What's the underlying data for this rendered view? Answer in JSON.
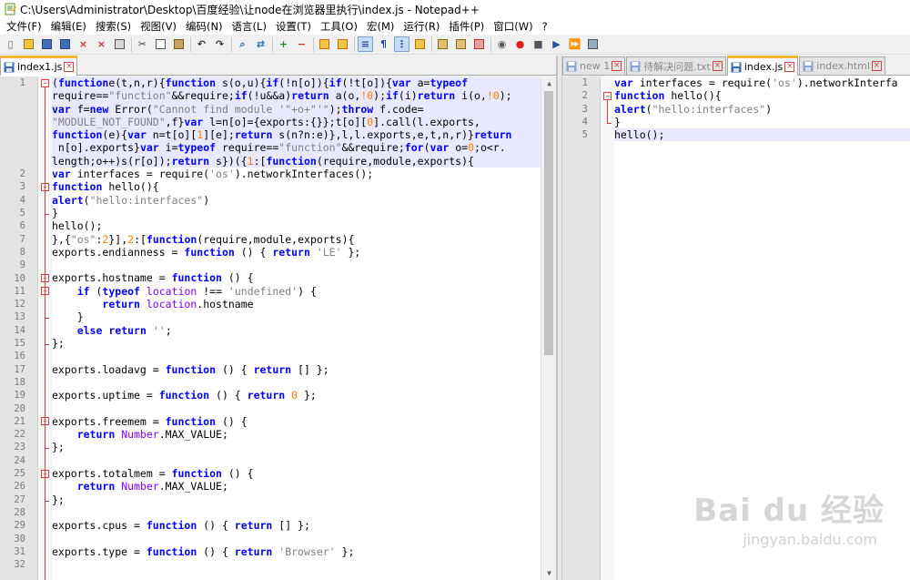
{
  "window": {
    "title": "C:\\Users\\Administrator\\Desktop\\百度经验\\让node在浏览器里执行\\index.js - Notepad++"
  },
  "menu": [
    "文件(F)",
    "编辑(E)",
    "搜索(S)",
    "视图(V)",
    "编码(N)",
    "语言(L)",
    "设置(T)",
    "工具(O)",
    "宏(M)",
    "运行(R)",
    "插件(P)",
    "窗口(W)",
    "?"
  ],
  "toolbar": {
    "icons": [
      "new-file-icon",
      "open-file-icon",
      "save-icon",
      "save-all-icon",
      "close-icon",
      "close-all-icon",
      "print-icon",
      "cut-icon",
      "copy-icon",
      "paste-icon",
      "undo-icon",
      "redo-icon",
      "find-icon",
      "replace-icon",
      "zoom-in-icon",
      "zoom-out-icon",
      "sync-vertical-icon",
      "sync-horizontal-icon",
      "word-wrap-icon",
      "show-all-chars-icon",
      "indent-guide-icon",
      "user-lang-icon",
      "doc-map-icon",
      "function-list-icon",
      "folder-workspace-icon",
      "monitor-icon",
      "macro-record-icon",
      "macro-stop-icon",
      "macro-play-icon",
      "macro-play-multi-icon",
      "macro-save-icon"
    ],
    "active": [
      "word-wrap-icon",
      "indent-guide-icon"
    ]
  },
  "left": {
    "tabs": [
      {
        "label": "index1.js",
        "active": true
      }
    ],
    "lines": [
      {
        "n": "1",
        "fold": "open",
        "wrapped": true,
        "hl": true,
        "segs": [
          [
            "sym",
            "("
          ],
          [
            "kw",
            "function"
          ],
          [
            "",
            "e(t,n,r){"
          ],
          [
            "kw",
            "function"
          ],
          [
            "",
            " s(o,u){"
          ],
          [
            "kw",
            "if"
          ],
          [
            "",
            "(!n[o]){"
          ],
          [
            "kw",
            "if"
          ],
          [
            "",
            "(!t[o]){"
          ],
          [
            "kw",
            "var"
          ],
          [
            "",
            " a="
          ],
          [
            "kw",
            "typeof"
          ]
        ]
      },
      {
        "n": "",
        "wrapped": true,
        "hl": true,
        "segs": [
          [
            "",
            "require=="
          ],
          [
            "str",
            "\"function\""
          ],
          [
            "",
            "&&require;"
          ],
          [
            "kw",
            "if"
          ],
          [
            "",
            "(!u&&a)"
          ],
          [
            "kw",
            "return"
          ],
          [
            "",
            " a(o,"
          ],
          [
            "num",
            "!0"
          ],
          [
            ");"
          ],
          [
            "kw",
            "if"
          ],
          [
            "",
            "(i)"
          ],
          [
            "kw",
            "return"
          ],
          [
            "",
            " i(o,"
          ],
          [
            "num",
            "!0"
          ],
          [
            ");"
          ]
        ]
      },
      {
        "n": "",
        "wrapped": true,
        "hl": true,
        "segs": [
          [
            "kw",
            "var"
          ],
          [
            "",
            " f="
          ],
          [
            "kw",
            "new"
          ],
          [
            "",
            " Error("
          ],
          [
            "str",
            "\"Cannot find module '\"+o+\"'\""
          ],
          [
            ");"
          ],
          [
            "kw",
            "throw"
          ],
          [
            "",
            " f.code="
          ]
        ]
      },
      {
        "n": "",
        "wrapped": true,
        "hl": true,
        "segs": [
          [
            "str",
            "\"MODULE_NOT_FOUND\""
          ],
          [
            ",f}"
          ],
          [
            "kw",
            "var"
          ],
          [
            "",
            " l=n[o]={exports:{}};t[o]["
          ],
          [
            "num",
            "0"
          ],
          [
            "].call(l.exports,"
          ]
        ]
      },
      {
        "n": "",
        "wrapped": true,
        "hl": true,
        "segs": [
          [
            "kw",
            "function"
          ],
          [
            "",
            "(e){"
          ],
          [
            "kw",
            "var"
          ],
          [
            "",
            " n=t[o]["
          ],
          [
            "num",
            "1"
          ],
          [
            "][e];"
          ],
          [
            "kw",
            "return"
          ],
          [
            "",
            " s(n?n:e)},l,l.exports,e,t,n,r)}"
          ],
          [
            "kw",
            "return"
          ]
        ]
      },
      {
        "n": "",
        "wrapped": true,
        "hl": true,
        "segs": [
          [
            "",
            " n[o].exports}"
          ],
          [
            "kw",
            "var"
          ],
          [
            "",
            " i="
          ],
          [
            "kw",
            "typeof"
          ],
          [
            "",
            " require=="
          ],
          [
            "str",
            "\"function\""
          ],
          [
            "",
            "&&require;"
          ],
          [
            "kw",
            "for"
          ],
          [
            "",
            "("
          ],
          [
            "kw",
            "var"
          ],
          [
            "",
            " o="
          ],
          [
            "num",
            "0"
          ],
          [
            ";o<r."
          ]
        ]
      },
      {
        "n": "",
        "wrapped": true,
        "hl": true,
        "segs": [
          [
            "",
            "length;o++)s(r[o]);"
          ],
          [
            "kw",
            "return"
          ],
          [
            "",
            " s})({"
          ],
          [
            "num",
            "1"
          ],
          [
            ":["
          ],
          [
            "kw",
            "function"
          ],
          [
            "",
            "(require,module,exports){"
          ]
        ]
      },
      {
        "n": "2",
        "segs": [
          [
            "kw",
            "var"
          ],
          [
            "",
            " interfaces = require("
          ],
          [
            "str",
            "'os'"
          ],
          [
            ").networkInterfaces();"
          ]
        ]
      },
      {
        "n": "3",
        "fold": "open",
        "segs": [
          [
            "kw",
            "function"
          ],
          [
            "",
            " hello(){"
          ]
        ]
      },
      {
        "n": "4",
        "segs": [
          [
            "kw",
            "alert"
          ],
          [
            "",
            "("
          ],
          [
            "str",
            "\"hello:interfaces\""
          ],
          [
            ")"
          ]
        ]
      },
      {
        "n": "5",
        "fold": "end",
        "segs": [
          [
            "",
            "}"
          ]
        ]
      },
      {
        "n": "6",
        "segs": [
          [
            "",
            "hello();"
          ]
        ]
      },
      {
        "n": "7",
        "segs": [
          [
            "",
            "},{"
          ],
          [
            "str",
            "\"os\""
          ],
          [
            ":"
          ],
          [
            "num",
            "2"
          ],
          [
            "}],"
          ],
          [
            "num",
            "2"
          ],
          [
            ":["
          ],
          [
            "kw",
            "function"
          ],
          [
            "",
            "(require,module,exports){"
          ]
        ]
      },
      {
        "n": "8",
        "segs": [
          [
            "",
            "exports.endianness = "
          ],
          [
            "kw",
            "function"
          ],
          [
            "",
            " () { "
          ],
          [
            "kw",
            "return"
          ],
          [
            "",
            " "
          ],
          [
            "str",
            "'LE'"
          ],
          [
            " };"
          ]
        ]
      },
      {
        "n": "9",
        "segs": []
      },
      {
        "n": "10",
        "fold": "open",
        "segs": [
          [
            "",
            "exports.hostname = "
          ],
          [
            "kw",
            "function"
          ],
          [
            "",
            " () {"
          ]
        ]
      },
      {
        "n": "11",
        "fold": "open",
        "segs": [
          [
            "",
            "    "
          ],
          [
            "kw",
            "if"
          ],
          [
            "",
            " ("
          ],
          [
            "kw",
            "typeof"
          ],
          [
            "",
            " "
          ],
          [
            "fn",
            "location"
          ],
          [
            "",
            " !== "
          ],
          [
            "str",
            "'undefined'"
          ],
          [
            ") {"
          ]
        ]
      },
      {
        "n": "12",
        "segs": [
          [
            "",
            "        "
          ],
          [
            "kw",
            "return"
          ],
          [
            "",
            " "
          ],
          [
            "fn",
            "location"
          ],
          [
            "",
            ".hostname"
          ]
        ]
      },
      {
        "n": "13",
        "fold": "end",
        "segs": [
          [
            "",
            "    }"
          ]
        ]
      },
      {
        "n": "14",
        "segs": [
          [
            "",
            "    "
          ],
          [
            "kw",
            "else"
          ],
          [
            "",
            " "
          ],
          [
            "kw",
            "return"
          ],
          [
            "",
            " "
          ],
          [
            "str",
            "''"
          ],
          [
            ";"
          ]
        ]
      },
      {
        "n": "15",
        "fold": "end",
        "segs": [
          [
            "",
            "};"
          ]
        ]
      },
      {
        "n": "16",
        "segs": []
      },
      {
        "n": "17",
        "segs": [
          [
            "",
            "exports.loadavg = "
          ],
          [
            "kw",
            "function"
          ],
          [
            "",
            " () { "
          ],
          [
            "kw",
            "return"
          ],
          [
            "",
            " [] };"
          ]
        ]
      },
      {
        "n": "18",
        "segs": []
      },
      {
        "n": "19",
        "segs": [
          [
            "",
            "exports.uptime = "
          ],
          [
            "kw",
            "function"
          ],
          [
            "",
            " () { "
          ],
          [
            "kw",
            "return"
          ],
          [
            "",
            " "
          ],
          [
            "num",
            "0"
          ],
          [
            " };"
          ]
        ]
      },
      {
        "n": "20",
        "segs": []
      },
      {
        "n": "21",
        "fold": "open",
        "segs": [
          [
            "",
            "exports.freemem = "
          ],
          [
            "kw",
            "function"
          ],
          [
            "",
            " () {"
          ]
        ]
      },
      {
        "n": "22",
        "segs": [
          [
            "",
            "    "
          ],
          [
            "kw",
            "return"
          ],
          [
            "",
            " "
          ],
          [
            "fn",
            "Number"
          ],
          [
            "",
            ".MAX_VALUE;"
          ]
        ]
      },
      {
        "n": "23",
        "fold": "end",
        "segs": [
          [
            "",
            "};"
          ]
        ]
      },
      {
        "n": "24",
        "segs": []
      },
      {
        "n": "25",
        "fold": "open",
        "segs": [
          [
            "",
            "exports.totalmem = "
          ],
          [
            "kw",
            "function"
          ],
          [
            "",
            " () {"
          ]
        ]
      },
      {
        "n": "26",
        "segs": [
          [
            "",
            "    "
          ],
          [
            "kw",
            "return"
          ],
          [
            "",
            " "
          ],
          [
            "fn",
            "Number"
          ],
          [
            "",
            ".MAX_VALUE;"
          ]
        ]
      },
      {
        "n": "27",
        "fold": "end",
        "segs": [
          [
            "",
            "};"
          ]
        ]
      },
      {
        "n": "28",
        "segs": []
      },
      {
        "n": "29",
        "segs": [
          [
            "",
            "exports.cpus = "
          ],
          [
            "kw",
            "function"
          ],
          [
            "",
            " () { "
          ],
          [
            "kw",
            "return"
          ],
          [
            "",
            " [] };"
          ]
        ]
      },
      {
        "n": "30",
        "segs": []
      },
      {
        "n": "31",
        "segs": [
          [
            "",
            "exports.type = "
          ],
          [
            "kw",
            "function"
          ],
          [
            "",
            " () { "
          ],
          [
            "kw",
            "return"
          ],
          [
            "",
            " "
          ],
          [
            "str",
            "'Browser'"
          ],
          [
            " };"
          ]
        ]
      },
      {
        "n": "32",
        "segs": []
      }
    ]
  },
  "right": {
    "tabs": [
      {
        "label": "new 1",
        "active": false
      },
      {
        "label": "待解决问题.txt",
        "active": false
      },
      {
        "label": "index.js",
        "active": true
      },
      {
        "label": "index.html",
        "active": false
      }
    ],
    "lines": [
      {
        "n": "1",
        "segs": [
          [
            "kw",
            "var"
          ],
          [
            "",
            " interfaces = require("
          ],
          [
            "str",
            "'os'"
          ],
          [
            ").networkInterfa"
          ]
        ]
      },
      {
        "n": "2",
        "fold": "open",
        "segs": [
          [
            "kw",
            "function"
          ],
          [
            "",
            " hello(){"
          ]
        ]
      },
      {
        "n": "3",
        "segs": [
          [
            "kw",
            "alert"
          ],
          [
            "",
            "("
          ],
          [
            "str",
            "\"hello:interfaces\""
          ],
          [
            ")"
          ]
        ]
      },
      {
        "n": "4",
        "fold": "end",
        "segs": [
          [
            "",
            "}"
          ]
        ]
      },
      {
        "n": "5",
        "hl": true,
        "segs": [
          [
            "",
            "hello();"
          ]
        ]
      }
    ]
  },
  "watermark": {
    "brand": "Bai du 经验",
    "url": "jingyan.baidu.com"
  },
  "colors": {
    "keyword": "#0000ff",
    "string": "#808080",
    "number": "#ff8000",
    "builtin": "#8000ff",
    "currentLine": "#e8e8ff",
    "foldMarker": "#e03c3c",
    "activeTab": "#f7b733"
  }
}
